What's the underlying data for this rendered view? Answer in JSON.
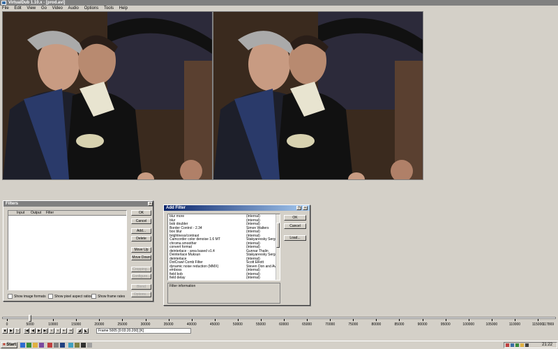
{
  "window": {
    "title": "VirtualDub 1.10.x - [prod.avi]"
  },
  "menu": [
    "File",
    "Edit",
    "View",
    "Go",
    "Video",
    "Audio",
    "Options",
    "Tools",
    "Help"
  ],
  "filters_dialog": {
    "title": "Filters",
    "columns": [
      "Input",
      "Output",
      "Filter"
    ],
    "buttons": {
      "ok": "OK",
      "cancel": "Cancel",
      "add": "Add...",
      "delete": "Delete",
      "move_up": "Move Up",
      "move_down": "Move Down",
      "cropping": "Cropping...",
      "configure": "Configure...",
      "blend": "Blend",
      "options": "Options..."
    },
    "checkboxes": {
      "show_image_formats": "Show image formats",
      "show_pixel_aspect": "Show pixel aspect ratios",
      "show_frame_rates": "Show frame rates"
    }
  },
  "add_filter_dialog": {
    "title": "Add Filter",
    "filters": [
      {
        "name": "blur more",
        "author": "(internal)"
      },
      {
        "name": "blur",
        "author": "(internal)"
      },
      {
        "name": "bob doubler",
        "author": "(internal)"
      },
      {
        "name": "Border Control - 2.34",
        "author": "Simon Walters"
      },
      {
        "name": "box blur",
        "author": "(internal)"
      },
      {
        "name": "brightness/contrast",
        "author": "(internal)"
      },
      {
        "name": "Camcorder color denoise 1.6 MT",
        "author": "Stakyarevsky Sergey"
      },
      {
        "name": "chroma smoother",
        "author": "(internal)"
      },
      {
        "name": "convert format",
        "author": "(internal)"
      },
      {
        "name": "deinterlace - area based v1.4",
        "author": "Gunnar Thalin"
      },
      {
        "name": "Deinterlace Muksun",
        "author": "Stakyarevsky Sergey"
      },
      {
        "name": "deinterlace",
        "author": "(internal)"
      },
      {
        "name": "DotCrawl Comb Filter",
        "author": "Scott Elliott"
      },
      {
        "name": "dynamic noise reduction (MMX)",
        "author": "Steven Don and Aver"
      },
      {
        "name": "emboss",
        "author": "(internal)"
      },
      {
        "name": "field bob",
        "author": "(internal)"
      },
      {
        "name": "field delay",
        "author": "(internal)"
      }
    ],
    "info_label": "Filter information",
    "buttons": {
      "ok": "OK",
      "cancel": "Cancel",
      "load": "Load..."
    }
  },
  "timeline": {
    "labels": [
      "0",
      "5000",
      "10000",
      "15000",
      "20000",
      "25000",
      "30000",
      "35000",
      "40000",
      "45000",
      "50000",
      "55000",
      "60000",
      "65000",
      "70000",
      "75000",
      "80000",
      "85000",
      "90000",
      "95000",
      "100000",
      "105000",
      "110000",
      "115000"
    ],
    "end_label": "117869",
    "position": 5005,
    "max": 117869,
    "frame_status": "Frame 5005 [0:03:20.200] [K]"
  },
  "taskbar": {
    "start": "Start",
    "clock": "21:22"
  }
}
